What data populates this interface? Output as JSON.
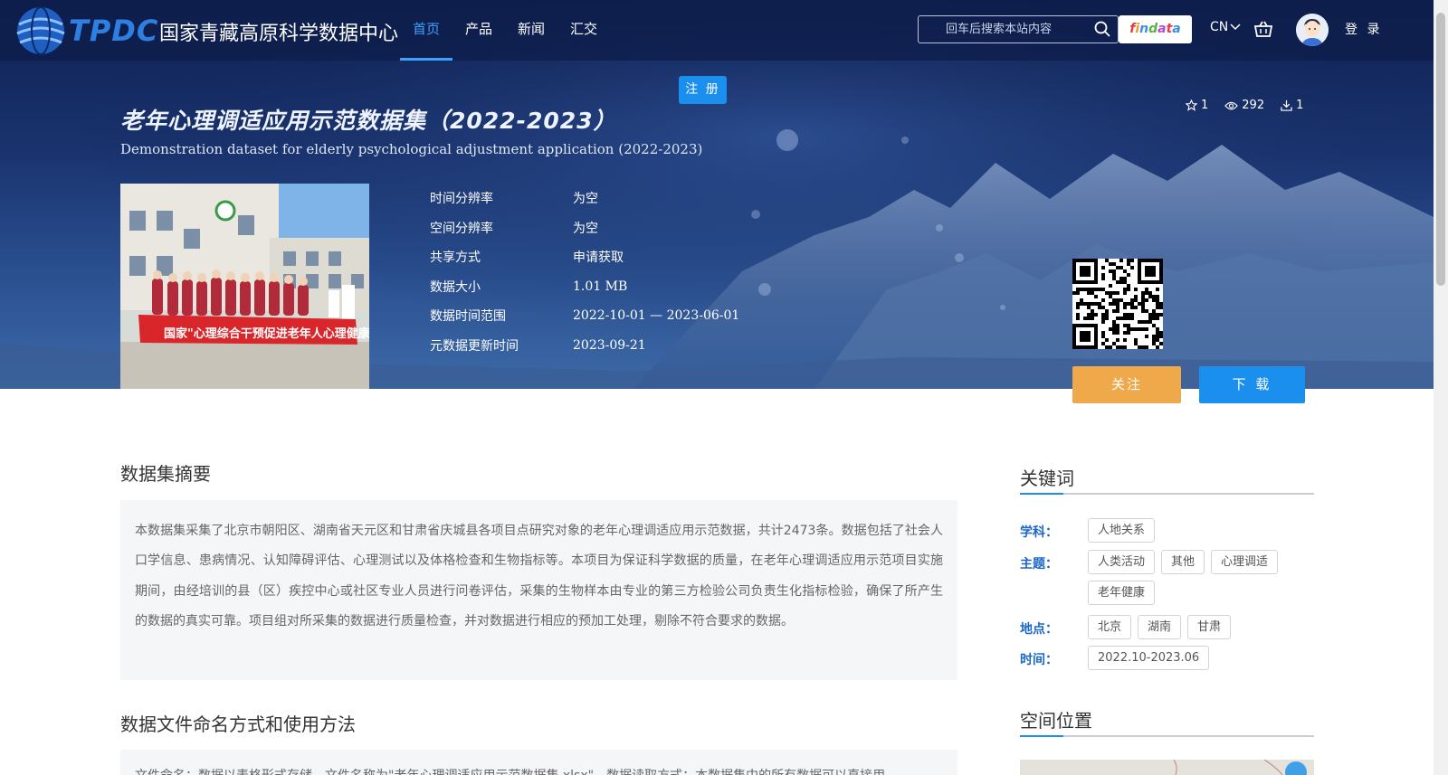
{
  "header": {
    "logo_abbr": "TPDC",
    "logo_name": "国家青藏高原科学数据中心",
    "nav": [
      {
        "label": "首页",
        "active": true
      },
      {
        "label": "产品",
        "active": false
      },
      {
        "label": "新闻",
        "active": false
      },
      {
        "label": "汇交",
        "active": false
      }
    ],
    "search_placeholder": "回车后搜索本站内容",
    "findata_label": "findata",
    "lang": "CN",
    "login_label": "登 录",
    "register_label": "注 册"
  },
  "dataset": {
    "title_cn": "老年心理调适应用示范数据集（2022-2023）",
    "title_en": "Demonstration dataset for elderly psychological adjustment application (2022-2023)",
    "stats": {
      "favorites": "1",
      "views": "292",
      "downloads": "1"
    },
    "meta": [
      {
        "key": "时间分辨率",
        "value": "为空"
      },
      {
        "key": "空间分辨率",
        "value": "为空"
      },
      {
        "key": "共享方式",
        "value": "申请获取"
      },
      {
        "key": "数据大小",
        "value": "1.01 MB"
      },
      {
        "key": "数据时间范围",
        "value": "2022-10-01 — 2023-06-01"
      },
      {
        "key": "元数据更新时间",
        "value": "2023-09-21"
      }
    ],
    "follow_label": "关注",
    "download_label": "下 载"
  },
  "main": {
    "abstract_title": "数据集摘要",
    "abstract_text": "本数据集采集了北京市朝阳区、湖南省天元区和甘肃省庆城县各项目点研究对象的老年心理调适应用示范数据，共计2473条。数据包括了社会人口学信息、患病情况、认知障碍评估、心理测试以及体格检查和生物指标等。本项目为保证科学数据的质量，在老年心理调适应用示范项目实施期间，由经培训的县（区）疾控中心或社区专业人员进行问卷评估，采集的生物样本由专业的第三方检验公司负责生化指标检验，确保了所产生的数据的真实可靠。项目组对所采集的数据进行质量检查，并对数据进行相应的预加工处理，剔除不符合要求的数据。",
    "usage_title": "数据文件命名方式和使用方法",
    "usage_text": "文件命名：数据以表格形式存储，文件名称为\"老年心理调适应用示范数据集.xlsx\"，数据读取方式：本数据集中的所有数据可以直接用"
  },
  "sidebar": {
    "keywords_title": "关键词",
    "subject_label": "学科：",
    "subject_tags": [
      "人地关系"
    ],
    "theme_label": "主题：",
    "theme_tags": [
      "人类活动",
      "其他",
      "心理调适",
      "老年健康"
    ],
    "place_label": "地点：",
    "place_tags": [
      "北京",
      "湖南",
      "甘肃"
    ],
    "time_label": "时间：",
    "time_tags": [
      "2022.10-2023.06"
    ],
    "spatial_title": "空间位置"
  },
  "cover_banner_text": "国家\"心理综合干预促进老年人心理健康\"项目"
}
